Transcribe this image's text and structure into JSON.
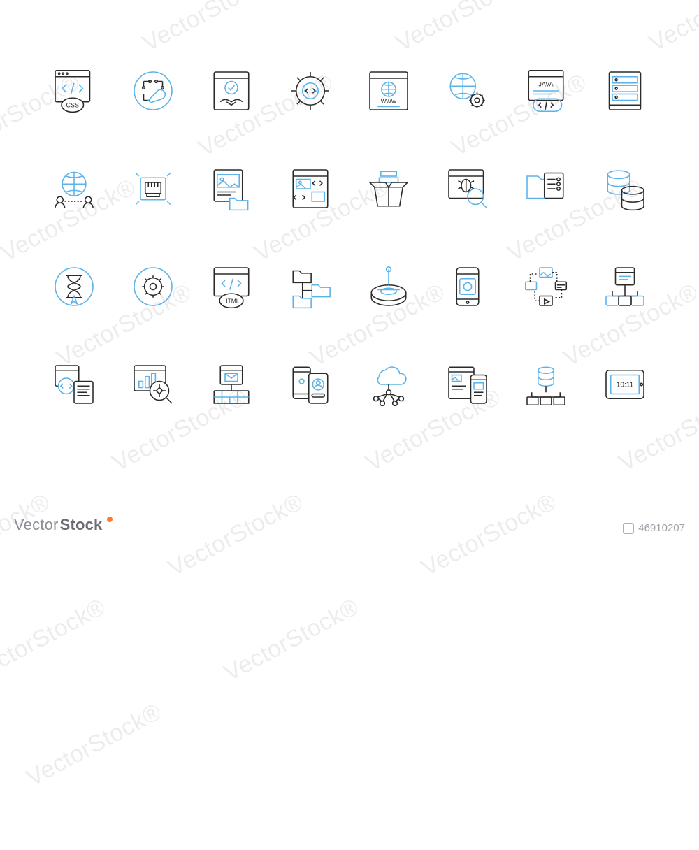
{
  "watermark_text": "VectorStock®",
  "footer": {
    "brand_left": "Vector",
    "brand_right": "Stock",
    "image_id": "46910207"
  },
  "icons": [
    {
      "name": "css-window-icon",
      "label": "CSS"
    },
    {
      "name": "circuit-wrench-icon",
      "label": ""
    },
    {
      "name": "handshake-badge-icon",
      "label": ""
    },
    {
      "name": "code-gear-icon",
      "label": ""
    },
    {
      "name": "www-browser-icon",
      "label": "WWW"
    },
    {
      "name": "globe-gear-icon",
      "label": ""
    },
    {
      "name": "java-window-icon",
      "label": "JAVA"
    },
    {
      "name": "server-rack-icon",
      "label": ""
    },
    {
      "name": "globe-users-icon",
      "label": ""
    },
    {
      "name": "ethernet-port-icon",
      "label": ""
    },
    {
      "name": "image-folder-icon",
      "label": ""
    },
    {
      "name": "image-code-window-icon",
      "label": ""
    },
    {
      "name": "box-unpack-icon",
      "label": ""
    },
    {
      "name": "bug-search-icon",
      "label": ""
    },
    {
      "name": "folder-file-icon",
      "label": ""
    },
    {
      "name": "database-stack-icon",
      "label": ""
    },
    {
      "name": "hourglass-badge-icon",
      "label": ""
    },
    {
      "name": "gear-ring-icon",
      "label": ""
    },
    {
      "name": "html-window-icon",
      "label": "HTML"
    },
    {
      "name": "folder-tree-icon",
      "label": ""
    },
    {
      "name": "scanner-device-icon",
      "label": ""
    },
    {
      "name": "mobile-card-icon",
      "label": ""
    },
    {
      "name": "media-cycle-icon",
      "label": ""
    },
    {
      "name": "site-network-icon",
      "label": ""
    },
    {
      "name": "code-document-icon",
      "label": ""
    },
    {
      "name": "analytics-lens-icon",
      "label": ""
    },
    {
      "name": "firewall-mail-icon",
      "label": ""
    },
    {
      "name": "mobile-user-icon",
      "label": ""
    },
    {
      "name": "cloud-network-icon",
      "label": ""
    },
    {
      "name": "dashboard-mobile-icon",
      "label": ""
    },
    {
      "name": "database-nodes-icon",
      "label": ""
    },
    {
      "name": "tablet-clock-icon",
      "label": "10:11"
    }
  ]
}
